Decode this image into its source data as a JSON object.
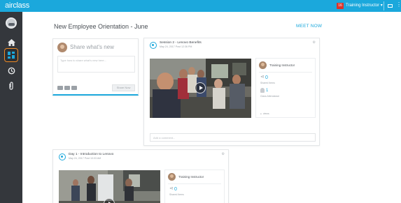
{
  "app": {
    "logo_prefix": "air",
    "logo_main": "class",
    "accent_color": "#1ba8dc",
    "sidebar_color": "#34373c",
    "active_color": "#f08a24"
  },
  "topbar": {
    "notification_count": "16",
    "user_label": "Training Instructor ▾",
    "mail_icon": "mail-icon",
    "more": "⋮"
  },
  "sidebar": {
    "items": [
      {
        "name": "home",
        "icon": "home-icon"
      },
      {
        "name": "classes",
        "icon": "grid-icon",
        "active": true
      },
      {
        "name": "history",
        "icon": "history-icon"
      },
      {
        "name": "attachments",
        "icon": "paperclip-icon"
      }
    ]
  },
  "page": {
    "title": "New Employee Orientation - June",
    "meet_now": "MEET NOW"
  },
  "composer": {
    "prompt": "Share what's new",
    "placeholder": "Type how to share what's new here...",
    "button": "Share Now"
  },
  "posts": [
    {
      "title": "Session 2 - Lenovo Benefits",
      "date": "May 24, 2017 Post 12:36 PM",
      "instructor": "Training Instructor",
      "shares": "0",
      "shares_label": "Shared Items",
      "attendance": "1",
      "attendance_label": "Class Attendance",
      "views": "views",
      "comment_placeholder": "Add a comment..."
    },
    {
      "title": "Day 1 - Introduction to Lenovo",
      "date": "May 24, 2017 Post 10:03 AM",
      "instructor": "Training Instructor",
      "shares": "0",
      "shares_label": "Shared Items"
    }
  ]
}
